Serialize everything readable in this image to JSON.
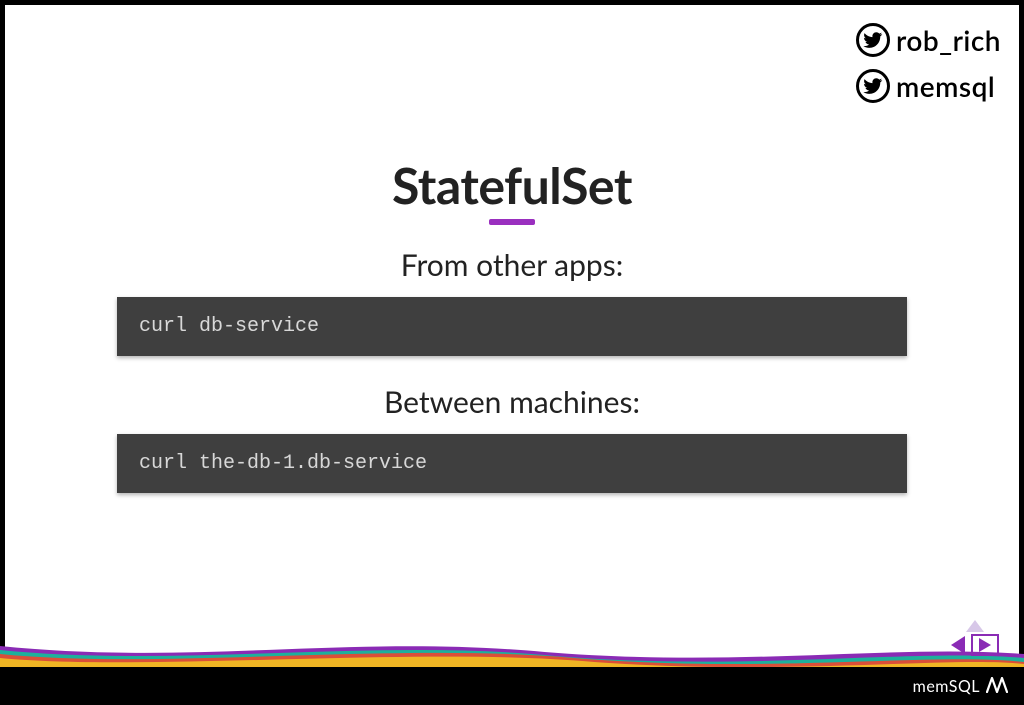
{
  "handles": [
    {
      "name": "rob_rich"
    },
    {
      "name": "memsql"
    }
  ],
  "title": "StatefulSet",
  "sections": [
    {
      "label": "From other apps:",
      "code": "curl db-service"
    },
    {
      "label": "Between machines:",
      "code": "curl the-db-1.db-service"
    }
  ],
  "footer_brand": "memSQL"
}
